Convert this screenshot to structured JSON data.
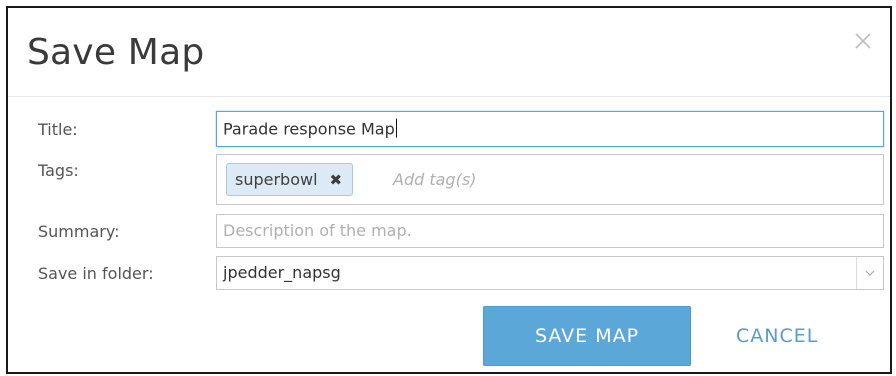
{
  "dialog": {
    "title": "Save Map",
    "close_icon": "close-icon"
  },
  "form": {
    "title": {
      "label": "Title:",
      "value": "Parade response Map"
    },
    "tags": {
      "label": "Tags:",
      "chips": [
        "superbowl"
      ],
      "remove_icon": "close-x-icon",
      "placeholder": "Add tag(s)"
    },
    "summary": {
      "label": "Summary:",
      "placeholder": "Description of the map."
    },
    "folder": {
      "label": "Save in folder:",
      "value": "jpedder_napsg",
      "arrow_icon": "chevron-down-icon"
    }
  },
  "actions": {
    "save_label": "SAVE MAP",
    "cancel_label": "CANCEL"
  },
  "colors": {
    "primary_button": "#5ba7d7",
    "link": "#5a9cc8",
    "focus_border": "#59a7d6",
    "tag_chip_bg": "#dceaf5"
  }
}
